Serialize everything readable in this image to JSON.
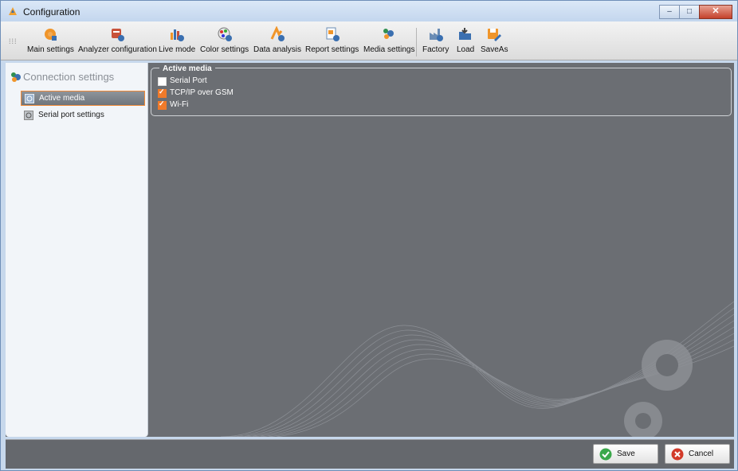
{
  "window": {
    "title": "Configuration",
    "controls": {
      "minimize": "–",
      "maximize": "□",
      "close": "✕"
    }
  },
  "toolbar": {
    "items": [
      {
        "label": "Main settings",
        "icon": "gear-icon"
      },
      {
        "label": "Analyzer configuration",
        "icon": "analyzer-icon"
      },
      {
        "label": "Live mode",
        "icon": "live-mode-icon"
      },
      {
        "label": "Color settings",
        "icon": "color-palette-icon"
      },
      {
        "label": "Data analysis",
        "icon": "data-analysis-icon"
      },
      {
        "label": "Report settings",
        "icon": "report-icon"
      },
      {
        "label": "Media settings",
        "icon": "media-icon"
      },
      {
        "label": "Factory",
        "icon": "factory-icon"
      },
      {
        "label": "Load",
        "icon": "load-icon"
      },
      {
        "label": "SaveAs",
        "icon": "save-as-icon"
      }
    ]
  },
  "sidebar": {
    "header": "Connection settings",
    "items": [
      {
        "label": "Active media",
        "active": true
      },
      {
        "label": "Serial port settings",
        "active": false
      }
    ]
  },
  "active_media": {
    "title": "Active media",
    "options": [
      {
        "label": "Serial Port",
        "checked": false
      },
      {
        "label": "TCP/IP over GSM",
        "checked": true
      },
      {
        "label": "Wi-Fi",
        "checked": true
      }
    ]
  },
  "footer": {
    "save_label": "Save",
    "cancel_label": "Cancel"
  },
  "colors": {
    "accent": "#f07a2a",
    "panel_bg": "#6b6e73",
    "sidebar_bg": "#f2f5f9"
  }
}
